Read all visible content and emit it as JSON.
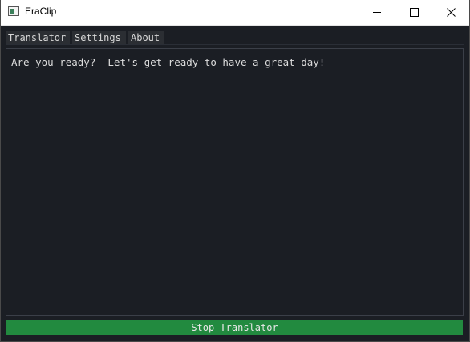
{
  "window": {
    "title": "EraClip",
    "controls": {
      "minimize_icon": "minimize-icon",
      "maximize_icon": "maximize-icon",
      "close_icon": "close-icon"
    }
  },
  "tabs": [
    {
      "label": "Translator"
    },
    {
      "label": "Settings"
    },
    {
      "label": "About"
    }
  ],
  "main": {
    "text": "Are you ready?  Let's get ready to have a great day!"
  },
  "actions": {
    "stop_label": "Stop Translator"
  },
  "colors": {
    "background": "#1b1e24",
    "tab_background": "#2b2e33",
    "button_green": "#228a3f",
    "text": "#dcdcdc"
  }
}
